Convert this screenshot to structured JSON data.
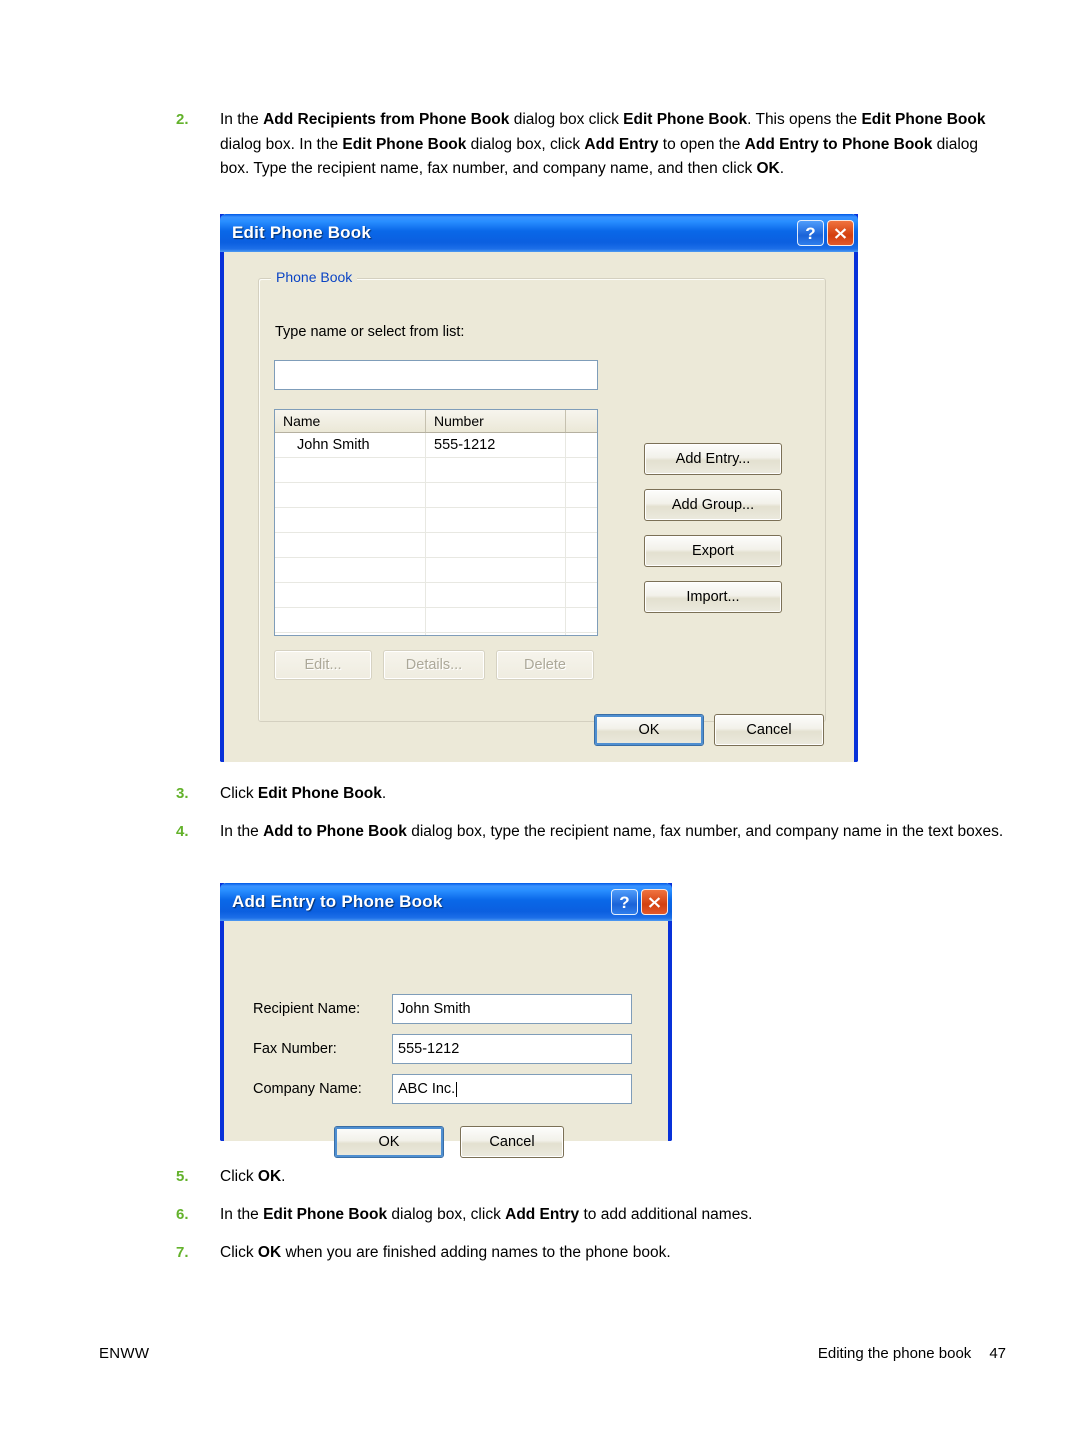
{
  "page": {
    "footer_left": "ENWW",
    "footer_section": "Editing the phone book",
    "footer_page": "47"
  },
  "steps": [
    {
      "num": "2.",
      "html": "In the <b>Add Recipients from Phone Book</b> dialog box click <b>Edit Phone Book</b>. This opens the <b>Edit Phone Book</b> dialog box. In the <b>Edit Phone Book</b> dialog box, click <b>Add Entry</b> to open the <b>Add Entry to Phone Book</b> dialog box. Type the recipient name, fax number, and company name, and then click <b>OK</b>."
    },
    {
      "num": "3.",
      "html": "Click <b>Edit Phone Book</b>."
    },
    {
      "num": "4.",
      "html": "In the <b>Add to Phone Book</b> dialog box, type the recipient name, fax number, and company name in the text boxes."
    },
    {
      "num": "5.",
      "html": "Click <b>OK</b>."
    },
    {
      "num": "6.",
      "html": "In the <b>Edit Phone Book</b> dialog box, click <b>Add Entry</b> to add additional names."
    },
    {
      "num": "7.",
      "html": "Click <b>OK</b> when you are finished adding names to the phone book."
    }
  ],
  "dialog_edit_phone_book": {
    "title": "Edit Phone Book",
    "help_button": "?",
    "close_button": "✕",
    "group_label": "Phone Book",
    "name_prompt": "Type name or select from list:",
    "search_value": "",
    "list": {
      "columns": [
        "Name",
        "Number",
        ""
      ],
      "rows": [
        {
          "name": "John Smith",
          "number": "555-1212"
        },
        {
          "name": "",
          "number": ""
        },
        {
          "name": "",
          "number": ""
        },
        {
          "name": "",
          "number": ""
        },
        {
          "name": "",
          "number": ""
        },
        {
          "name": "",
          "number": ""
        },
        {
          "name": "",
          "number": ""
        },
        {
          "name": "",
          "number": ""
        },
        {
          "name": "",
          "number": ""
        }
      ]
    },
    "side_buttons": [
      {
        "label": "Add Entry...",
        "enabled": true
      },
      {
        "label": "Add Group...",
        "enabled": true
      },
      {
        "label": "Export",
        "enabled": true
      },
      {
        "label": "Import...",
        "enabled": true
      }
    ],
    "row_buttons": [
      {
        "label": "Edit...",
        "enabled": false
      },
      {
        "label": "Details...",
        "enabled": false
      },
      {
        "label": "Delete",
        "enabled": false
      }
    ],
    "ok_label": "OK",
    "cancel_label": "Cancel"
  },
  "dialog_add_entry": {
    "title": "Add Entry to Phone Book",
    "help_button": "?",
    "close_button": "✕",
    "fields": [
      {
        "label": "Recipient Name:",
        "value": "John Smith",
        "caret": false
      },
      {
        "label": "Fax Number:",
        "value": "555-1212",
        "caret": false
      },
      {
        "label": "Company Name:",
        "value": "ABC Inc.",
        "caret": true
      }
    ],
    "ok_label": "OK",
    "cancel_label": "Cancel"
  },
  "colors": {
    "step_number": "#63b22b",
    "titlebar_blue": "#0a5ce0",
    "dialog_face": "#ece9d8",
    "group_label_blue": "#0b44c4",
    "close_button_orange": "#d3400f"
  }
}
